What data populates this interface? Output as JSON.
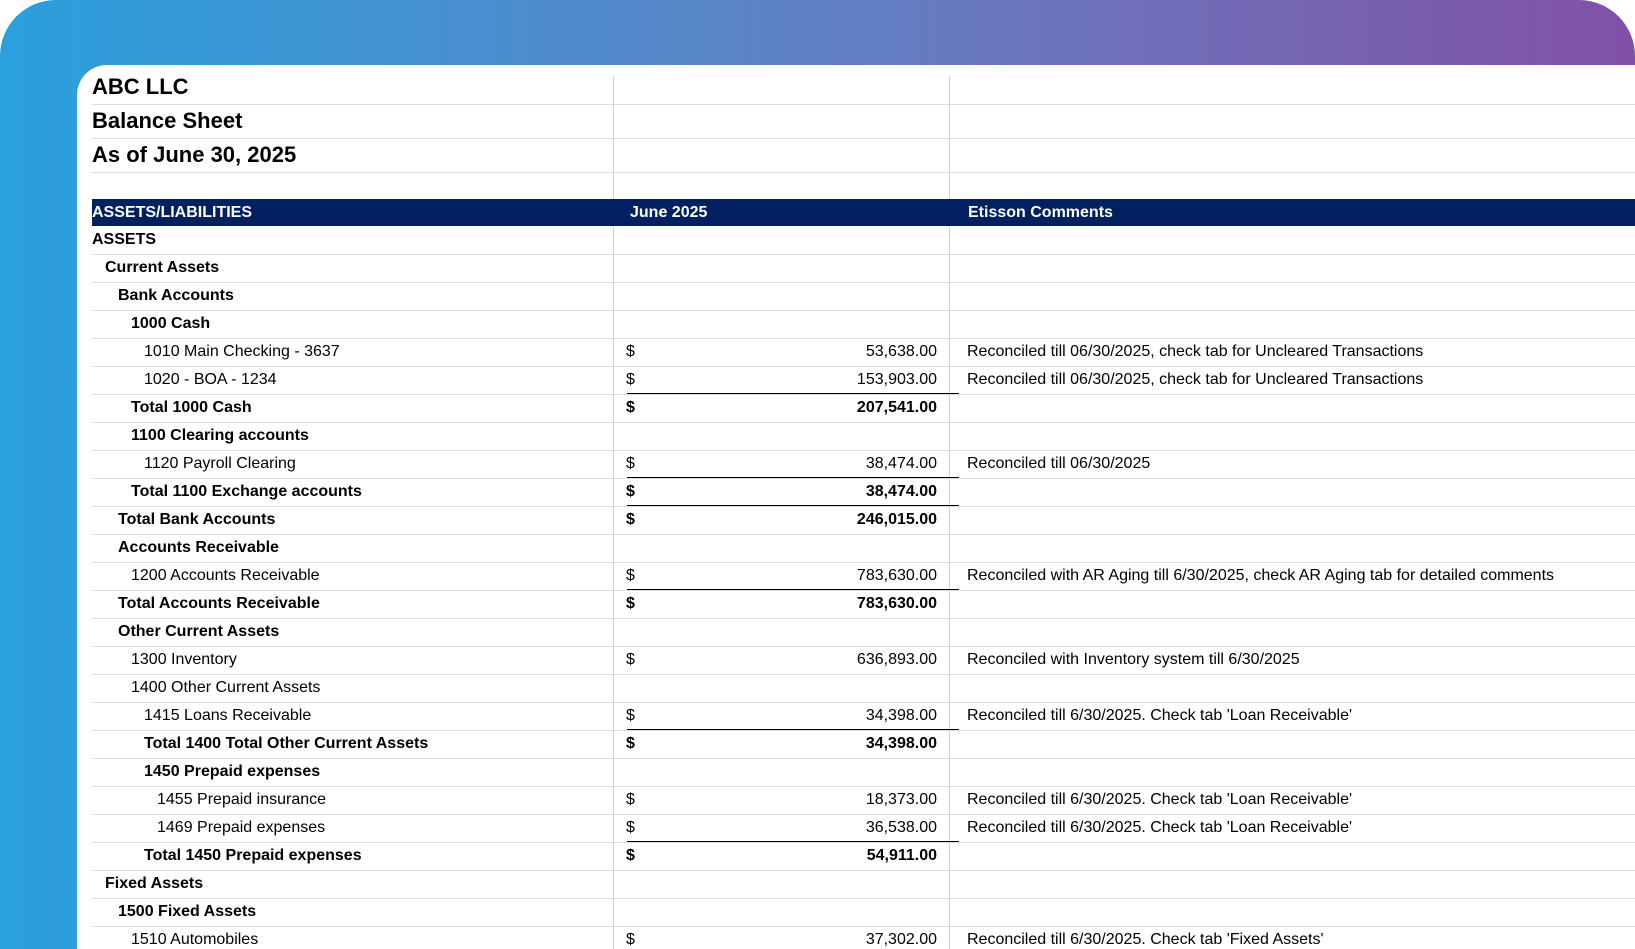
{
  "sheet": {
    "company": "ABC LLC",
    "report": "Balance Sheet",
    "as_of": "As of June 30, 2025"
  },
  "header": {
    "col1": "ASSETS/LIABILITIES",
    "col2": "June 2025",
    "col3": "Etisson Comments"
  },
  "rows": [
    {
      "label": "ASSETS",
      "indent": 0,
      "bold": true,
      "currency": "",
      "amount": "",
      "comment": ""
    },
    {
      "label": "Current Assets",
      "indent": 1,
      "bold": true,
      "currency": "",
      "amount": "",
      "comment": ""
    },
    {
      "label": "Bank Accounts",
      "indent": 2,
      "bold": true,
      "currency": "",
      "amount": "",
      "comment": ""
    },
    {
      "label": "1000 Cash",
      "indent": 3,
      "bold": true,
      "currency": "",
      "amount": "",
      "comment": ""
    },
    {
      "label": "1010 Main Checking - 3637",
      "indent": 4,
      "bold": false,
      "currency": "$",
      "amount": "53,638.00",
      "comment": "Reconciled till 06/30/2025, check tab for Uncleared Transactions"
    },
    {
      "label": "1020 - BOA - 1234",
      "indent": 4,
      "bold": false,
      "currency": "$",
      "amount": "153,903.00",
      "comment": "Reconciled till 06/30/2025, check tab for Uncleared Transactions"
    },
    {
      "label": "Total 1000 Cash",
      "indent": 3,
      "bold": true,
      "total": true,
      "currency": "$",
      "amount": "207,541.00",
      "comment": ""
    },
    {
      "label": "1100 Clearing accounts",
      "indent": 3,
      "bold": true,
      "currency": "",
      "amount": "",
      "comment": ""
    },
    {
      "label": "1120 Payroll Clearing",
      "indent": 4,
      "bold": false,
      "currency": "$",
      "amount": "38,474.00",
      "comment": "Reconciled till 06/30/2025"
    },
    {
      "label": "Total 1100 Exchange accounts",
      "indent": 3,
      "bold": true,
      "total": true,
      "currency": "$",
      "amount": "38,474.00",
      "comment": ""
    },
    {
      "label": "Total Bank Accounts",
      "indent": 2,
      "bold": true,
      "total": true,
      "currency": "$",
      "amount": "246,015.00",
      "comment": ""
    },
    {
      "label": "Accounts Receivable",
      "indent": 2,
      "bold": true,
      "currency": "",
      "amount": "",
      "comment": ""
    },
    {
      "label": "1200 Accounts Receivable",
      "indent": 3,
      "bold": false,
      "currency": "$",
      "amount": "783,630.00",
      "comment": "Reconciled with AR Aging till 6/30/2025, check AR Aging tab for detailed comments"
    },
    {
      "label": "Total Accounts Receivable",
      "indent": 2,
      "bold": true,
      "total": true,
      "currency": "$",
      "amount": "783,630.00",
      "comment": ""
    },
    {
      "label": "Other Current Assets",
      "indent": 2,
      "bold": true,
      "currency": "",
      "amount": "",
      "comment": ""
    },
    {
      "label": "1300 Inventory",
      "indent": 3,
      "bold": false,
      "currency": "$",
      "amount": "636,893.00",
      "comment": "Reconciled with Inventory system till 6/30/2025"
    },
    {
      "label": "1400 Other Current Assets",
      "indent": 3,
      "bold": false,
      "currency": "",
      "amount": "",
      "comment": ""
    },
    {
      "label": "1415 Loans Receivable",
      "indent": 4,
      "bold": false,
      "currency": "$",
      "amount": "34,398.00",
      "comment": "Reconciled till 6/30/2025. Check tab 'Loan Receivable'"
    },
    {
      "label": "Total 1400 Total Other Current Assets",
      "indent": 4,
      "bold": true,
      "total": true,
      "currency": "$",
      "amount": "34,398.00",
      "comment": ""
    },
    {
      "label": "1450 Prepaid expenses",
      "indent": 4,
      "bold": true,
      "currency": "",
      "amount": "",
      "comment": ""
    },
    {
      "label": "1455 Prepaid insurance",
      "indent": 5,
      "bold": false,
      "currency": "$",
      "amount": "18,373.00",
      "comment": "Reconciled till 6/30/2025. Check tab 'Loan Receivable'"
    },
    {
      "label": "1469 Prepaid expenses",
      "indent": 5,
      "bold": false,
      "currency": "$",
      "amount": "36,538.00",
      "comment": "Reconciled till 6/30/2025. Check tab 'Loan Receivable'"
    },
    {
      "label": "Total 1450 Prepaid expenses",
      "indent": 4,
      "bold": true,
      "total": true,
      "currency": "$",
      "amount": "54,911.00",
      "comment": ""
    },
    {
      "label": "Fixed Assets",
      "indent": 1,
      "bold": true,
      "currency": "",
      "amount": "",
      "comment": ""
    },
    {
      "label": "1500 Fixed Assets",
      "indent": 2,
      "bold": true,
      "currency": "",
      "amount": "",
      "comment": ""
    },
    {
      "label": "1510 Automobiles",
      "indent": 3,
      "bold": false,
      "currency": "$",
      "amount": "37,302.00",
      "comment": "Reconciled till 6/30/2025. Check tab 'Fixed Assets'"
    }
  ]
}
